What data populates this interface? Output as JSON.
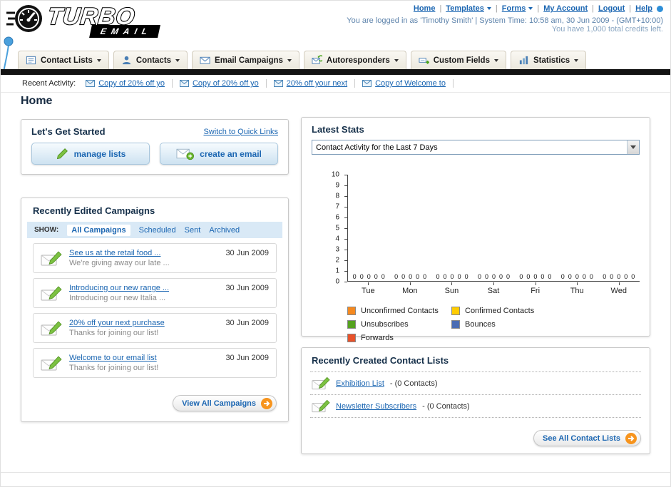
{
  "page_title": "Home",
  "header": {
    "logo_word1": "TURBO",
    "logo_word2": "EMAIL",
    "nav": {
      "home": "Home",
      "templates": "Templates",
      "forms": "Forms",
      "my_account": "My Account",
      "logout": "Logout",
      "help": "Help"
    },
    "login_info": "You are logged in as 'Timothy Smith' | System Time: 10:58 am, 30 Jun 2009 - (GMT+10:00)",
    "credits": "You have 1,000 total credits left."
  },
  "tabs": [
    {
      "label": "Contact Lists"
    },
    {
      "label": "Contacts"
    },
    {
      "label": "Email Campaigns"
    },
    {
      "label": "Autoresponders"
    },
    {
      "label": "Custom Fields"
    },
    {
      "label": "Statistics"
    }
  ],
  "recent_activity": {
    "label": "Recent Activity:",
    "items": [
      {
        "text": "Copy of 20% off yo"
      },
      {
        "text": "Copy of 20% off yo"
      },
      {
        "text": "20% off your next"
      },
      {
        "text": "Copy of Welcome to"
      }
    ]
  },
  "get_started": {
    "title": "Let's Get Started",
    "switch_link": "Switch to Quick Links",
    "manage_lists_button": "manage lists",
    "create_email_button": "create an email"
  },
  "campaigns": {
    "title": "Recently Edited Campaigns",
    "show_label": "SHOW:",
    "filters": [
      {
        "label": "All Campaigns"
      },
      {
        "label": "Scheduled"
      },
      {
        "label": "Sent"
      },
      {
        "label": "Archived"
      }
    ],
    "items": [
      {
        "title": "See us at the retail food ...",
        "subtitle": "We're giving away our late ...",
        "date": "30 Jun 2009"
      },
      {
        "title": "Introducing our new range ...",
        "subtitle": "Introducing our new Italia ...",
        "date": "30 Jun 2009"
      },
      {
        "title": "20% off your next purchase",
        "subtitle": "Thanks for joining our list!",
        "date": "30 Jun 2009"
      },
      {
        "title": "Welcome to our email list",
        "subtitle": "Thanks for joining our list!",
        "date": "30 Jun 2009"
      }
    ],
    "view_all_button": "View All Campaigns"
  },
  "stats": {
    "title": "Latest Stats",
    "dropdown_value": "Contact Activity for the Last 7 Days"
  },
  "chart_data": {
    "type": "bar",
    "title": "Contact Activity for the Last 7 Days",
    "categories": [
      "Tue",
      "Mon",
      "Sun",
      "Sat",
      "Fri",
      "Thu",
      "Wed"
    ],
    "series": [
      {
        "name": "Unconfirmed Contacts",
        "color": "#f5891f",
        "values": [
          0,
          0,
          0,
          0,
          0,
          0,
          0
        ]
      },
      {
        "name": "Confirmed Contacts",
        "color": "#ffcc00",
        "values": [
          0,
          0,
          0,
          0,
          0,
          0,
          0
        ]
      },
      {
        "name": "Unsubscribes",
        "color": "#55a21f",
        "values": [
          0,
          0,
          0,
          0,
          0,
          0,
          0
        ]
      },
      {
        "name": "Bounces",
        "color": "#4a6cb3",
        "values": [
          0,
          0,
          0,
          0,
          0,
          0,
          0
        ]
      },
      {
        "name": "Forwards",
        "color": "#e8522a",
        "values": [
          0,
          0,
          0,
          0,
          0,
          0,
          0
        ]
      }
    ],
    "ylim": [
      0,
      10
    ],
    "xlabel": "",
    "ylabel": "",
    "grid": false,
    "legend_position": "bottom"
  },
  "contact_lists": {
    "title": "Recently Created Contact Lists",
    "items": [
      {
        "name": "Exhibition List",
        "detail": "- (0 Contacts)"
      },
      {
        "name": "Newsletter Subscribers",
        "detail": "- (0 Contacts)"
      }
    ],
    "see_all_button": "See All Contact Lists"
  }
}
